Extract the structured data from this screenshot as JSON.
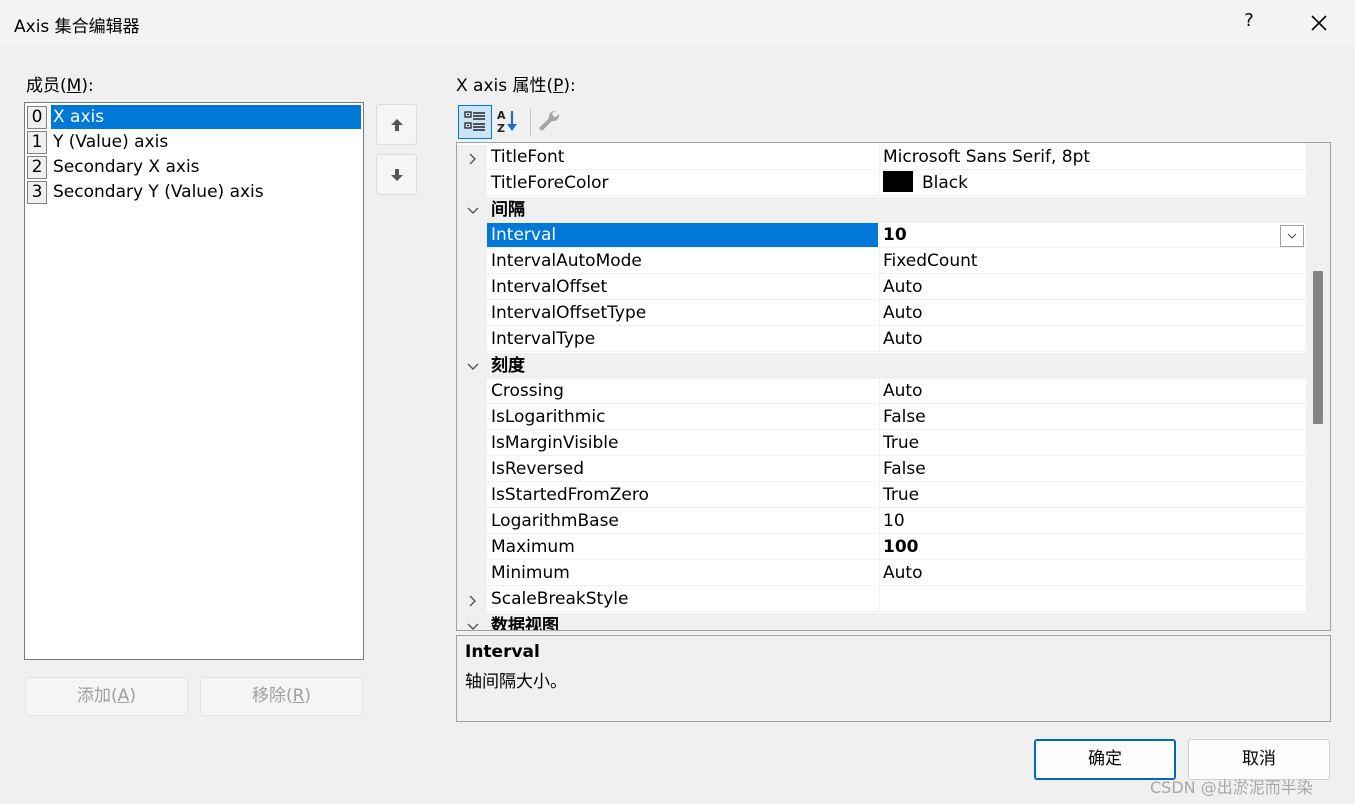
{
  "window": {
    "title": "Axis 集合编辑器",
    "help_glyph": "?",
    "close_icon": "close-icon"
  },
  "members": {
    "label_prefix": "成员(",
    "label_accel": "M",
    "label_suffix": "):",
    "items": [
      {
        "index": "0",
        "name": "X axis",
        "selected": true
      },
      {
        "index": "1",
        "name": "Y (Value) axis",
        "selected": false
      },
      {
        "index": "2",
        "name": "Secondary X axis",
        "selected": false
      },
      {
        "index": "3",
        "name": "Secondary Y (Value) axis",
        "selected": false
      }
    ],
    "move_up_icon": "arrow-up-icon",
    "move_down_icon": "arrow-down-icon",
    "add_prefix": "添加(",
    "add_accel": "A",
    "add_suffix": ")",
    "remove_prefix": "移除(",
    "remove_accel": "R",
    "remove_suffix": ")"
  },
  "properties": {
    "label_prefix": "X axis 属性(",
    "label_accel": "P",
    "label_suffix": "):",
    "toolbar": [
      "categorized-icon",
      "alphabetical-icon",
      "property-pages-icon"
    ],
    "rows": [
      {
        "kind": "prop",
        "name": "TitleFont",
        "value": "Microsoft Sans Serif, 8pt",
        "expandable": true
      },
      {
        "kind": "prop",
        "name": "TitleForeColor",
        "value": "Black",
        "swatch": "#000000"
      },
      {
        "kind": "category",
        "name": "间隔"
      },
      {
        "kind": "prop",
        "name": "Interval",
        "value": "10",
        "bold": true,
        "selected": true,
        "dropdown": true
      },
      {
        "kind": "prop",
        "name": "IntervalAutoMode",
        "value": "FixedCount"
      },
      {
        "kind": "prop",
        "name": "IntervalOffset",
        "value": "Auto"
      },
      {
        "kind": "prop",
        "name": "IntervalOffsetType",
        "value": "Auto"
      },
      {
        "kind": "prop",
        "name": "IntervalType",
        "value": "Auto"
      },
      {
        "kind": "category",
        "name": "刻度"
      },
      {
        "kind": "prop",
        "name": "Crossing",
        "value": "Auto"
      },
      {
        "kind": "prop",
        "name": "IsLogarithmic",
        "value": "False"
      },
      {
        "kind": "prop",
        "name": "IsMarginVisible",
        "value": "True"
      },
      {
        "kind": "prop",
        "name": "IsReversed",
        "value": "False"
      },
      {
        "kind": "prop",
        "name": "IsStartedFromZero",
        "value": "True"
      },
      {
        "kind": "prop",
        "name": "LogarithmBase",
        "value": "10"
      },
      {
        "kind": "prop",
        "name": "Maximum",
        "value": "100",
        "bold": true
      },
      {
        "kind": "prop",
        "name": "Minimum",
        "value": "Auto"
      },
      {
        "kind": "prop",
        "name": "ScaleBreakStyle",
        "value": "",
        "expandable": true
      },
      {
        "kind": "category",
        "name": "数据视图"
      }
    ]
  },
  "description": {
    "title": "Interval",
    "text": "轴间隔大小。"
  },
  "buttons": {
    "ok": "确定",
    "cancel": "取消"
  },
  "watermark": "CSDN @出淤泥而半染",
  "colors": {
    "selection": "#0078d7",
    "category_bg": "#f0f0f0"
  }
}
